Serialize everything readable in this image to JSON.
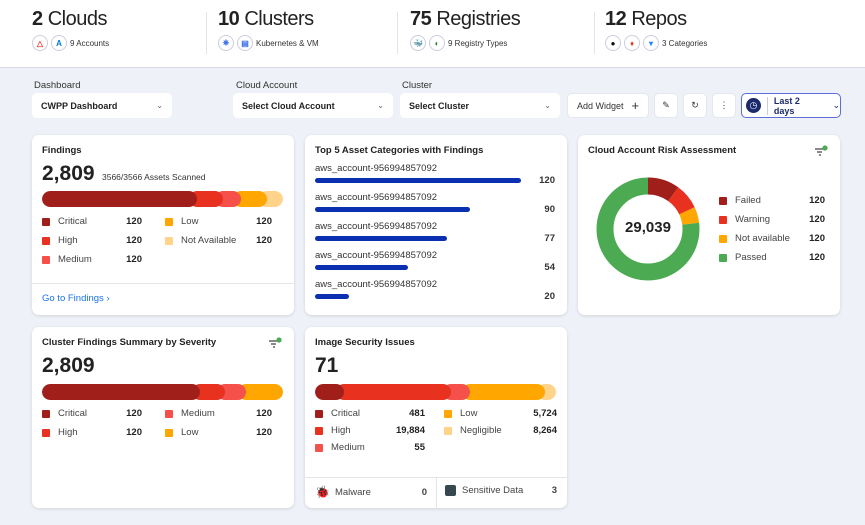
{
  "summary": [
    {
      "count": "2",
      "label": "Clouds",
      "sub": "9 Accounts",
      "icons": [
        "gcp-icon",
        "azure-icon"
      ]
    },
    {
      "count": "10",
      "label": "Clusters",
      "sub": "Kubernetes & VM",
      "icons": [
        "kubernetes-icon",
        "vm-icon"
      ]
    },
    {
      "count": "75",
      "label": "Registries",
      "sub": "9 Registry Types",
      "icons": [
        "docker-icon",
        "registry-icon"
      ]
    },
    {
      "count": "12",
      "label": "Repos",
      "sub": "3 Categories",
      "icons": [
        "github-icon",
        "gitlab-icon",
        "bitbucket-icon"
      ]
    }
  ],
  "filters": {
    "dashboard_label": "Dashboard",
    "dashboard_value": "CWPP Dashboard",
    "cloud_label": "Cloud Account",
    "cloud_value": "Select Cloud Account",
    "cluster_label": "Cluster",
    "cluster_value": "Select Cluster",
    "add_widget": "Add Widget",
    "time_range": "Last 2 days"
  },
  "colors": {
    "critical": "#a11f1a",
    "high": "#e8321f",
    "medium": "#f5504a",
    "low": "#ffa600",
    "na": "#ffd38a",
    "passed": "#4caa53",
    "bar": "#0a2fb0"
  },
  "findings": {
    "title": "Findings",
    "total": "2,809",
    "scanned": "3566/3566 Assets Scanned",
    "link": "Go to Findings",
    "bar_percent": [
      63,
      11,
      8,
      11,
      7
    ],
    "legend": [
      {
        "label": "Critical",
        "value": "120",
        "color": "critical"
      },
      {
        "label": "High",
        "value": "120",
        "color": "high"
      },
      {
        "label": "Medium",
        "value": "120",
        "color": "medium"
      },
      {
        "label": "Low",
        "value": "120",
        "color": "low"
      },
      {
        "label": "Not Available",
        "value": "120",
        "color": "na"
      }
    ]
  },
  "top5": {
    "title": "Top 5 Asset Categories with Findings",
    "items": [
      {
        "label": "aws_account-956994857092",
        "value": 120
      },
      {
        "label": "aws_account-956994857092",
        "value": 90
      },
      {
        "label": "aws_account-956994857092",
        "value": 77
      },
      {
        "label": "aws_account-956994857092",
        "value": 54
      },
      {
        "label": "aws_account-956994857092",
        "value": 20
      }
    ]
  },
  "risk": {
    "title": "Cloud Account Risk Assessment",
    "total": "29,039",
    "donut_percent": [
      {
        "color": "critical",
        "p": 10
      },
      {
        "color": "high",
        "p": 8
      },
      {
        "color": "low",
        "p": 5
      },
      {
        "color": "passed",
        "p": 77
      }
    ],
    "legend": [
      {
        "label": "Failed",
        "value": "120",
        "color": "critical"
      },
      {
        "label": "Warning",
        "value": "120",
        "color": "high"
      },
      {
        "label": "Not available",
        "value": "120",
        "color": "low"
      },
      {
        "label": "Passed",
        "value": "120",
        "color": "passed"
      }
    ]
  },
  "cluster": {
    "title": "Cluster Findings Summary by Severity",
    "total": "2,809",
    "bar_percent": [
      64,
      11,
      9,
      16
    ],
    "legend": [
      {
        "label": "Critical",
        "value": "120",
        "color": "critical"
      },
      {
        "label": "High",
        "value": "120",
        "color": "high"
      },
      {
        "label": "Medium",
        "value": "120",
        "color": "medium"
      },
      {
        "label": "Low",
        "value": "120",
        "color": "low"
      }
    ]
  },
  "image": {
    "title": "Image Security Issues",
    "total": "71",
    "bar_percent": [
      9,
      46,
      8,
      32,
      5
    ],
    "legend": [
      {
        "label": "Critical",
        "value": "481",
        "color": "critical"
      },
      {
        "label": "High",
        "value": "19,884",
        "color": "high"
      },
      {
        "label": "Medium",
        "value": "55",
        "color": "medium"
      },
      {
        "label": "Low",
        "value": "5,724",
        "color": "low"
      },
      {
        "label": "Negligible",
        "value": "8,264",
        "color": "na"
      }
    ],
    "malware_label": "Malware",
    "malware_value": "0",
    "sensitive_label": "Sensitive Data",
    "sensitive_value": "3"
  }
}
